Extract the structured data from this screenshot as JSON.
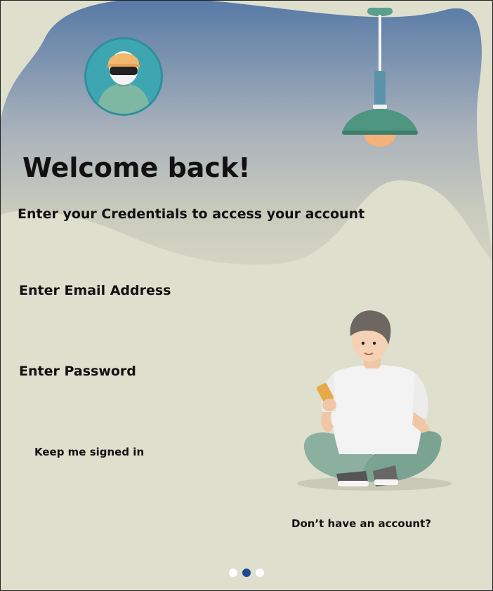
{
  "login": {
    "title": "Welcome back!",
    "subtitle": "Enter your Credentials to access your account",
    "email_placeholder": "Enter Email Address",
    "password_placeholder": "Enter Password",
    "keep_signed_in_label": "Keep me signed in",
    "signup_prompt": "Don’t have an account?"
  },
  "pager": {
    "page_count": 3,
    "active_page": 2
  },
  "icons": {
    "avatar": "user-avatar-icon",
    "lamp": "pendant-lamp-illustration",
    "person": "person-with-phone-illustration"
  },
  "colors": {
    "background": "#dedfcd",
    "header_gradient_top": "#5679a6",
    "header_gradient_bottom": "#c9cbbd",
    "text": "#111111",
    "pager_active": "#1b4a92",
    "pager_inactive": "#ffffff"
  }
}
